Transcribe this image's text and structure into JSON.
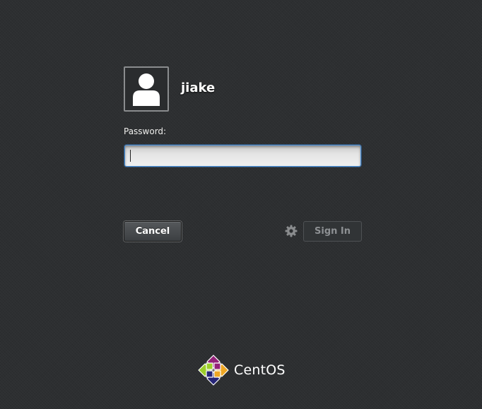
{
  "user": {
    "name": "jiake"
  },
  "password": {
    "label": "Password:",
    "value": "",
    "placeholder": ""
  },
  "buttons": {
    "cancel_label": "Cancel",
    "sign_in_label": "Sign In"
  },
  "icons": {
    "avatar": "user-avatar-icon",
    "settings": "gear-icon",
    "brand": "centos-logo-icon"
  },
  "branding": {
    "name": "CentOS"
  },
  "colors": {
    "background": "#2d2f31",
    "focus_ring": "#4a90d9",
    "disabled_text": "#8d9093"
  }
}
